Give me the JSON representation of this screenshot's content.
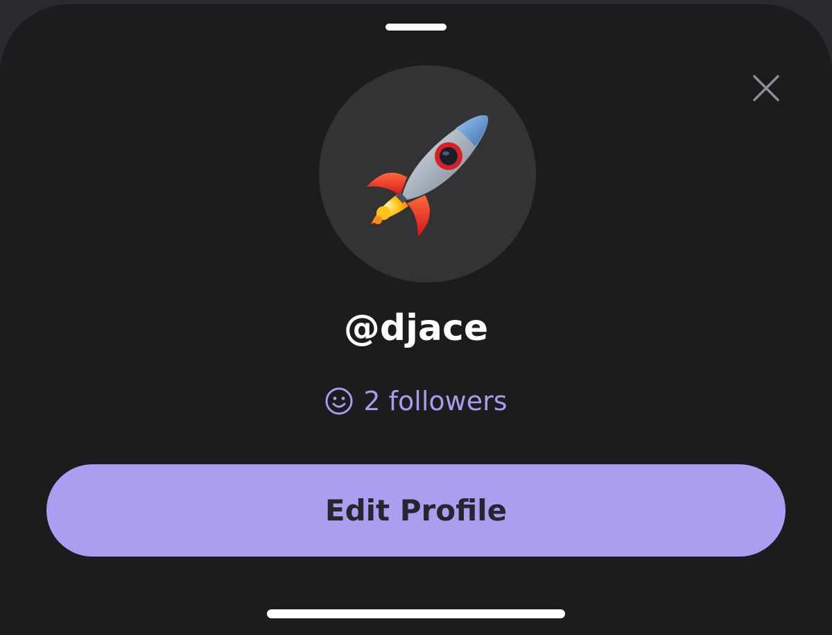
{
  "profile": {
    "username": "@djace",
    "followers_label": "2 followers",
    "avatar_icon": "rocket-icon"
  },
  "actions": {
    "edit_profile_label": "Edit Profile",
    "close_icon": "close-icon"
  },
  "colors": {
    "sheet_background": "#1c1c1e",
    "avatar_background": "#333335",
    "accent": "#a99ef0",
    "followers_text": "#a89cec"
  }
}
